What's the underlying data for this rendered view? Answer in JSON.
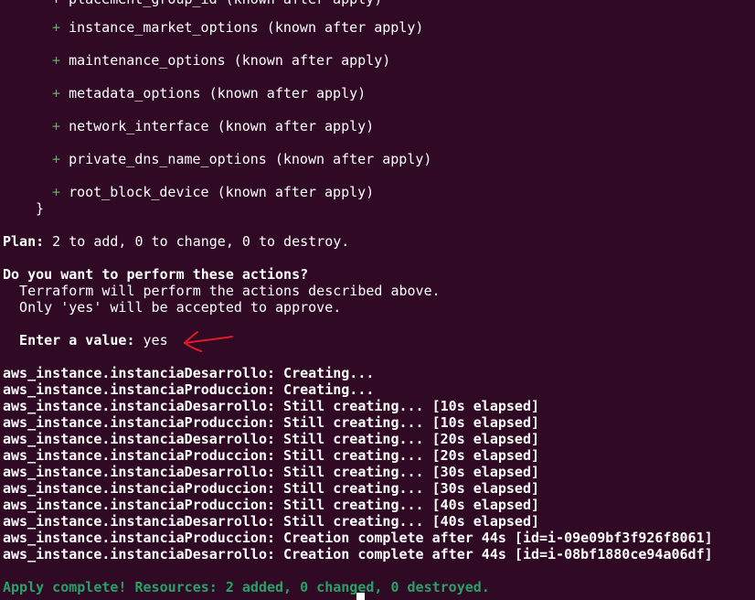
{
  "terminal": {
    "partial_top_line": "+ placement_group_id (known after apply)",
    "attributes": [
      {
        "marker": "+",
        "text": "instance_market_options (known after apply)"
      },
      {
        "marker": "+",
        "text": "maintenance_options (known after apply)"
      },
      {
        "marker": "+",
        "text": "metadata_options (known after apply)"
      },
      {
        "marker": "+",
        "text": "network_interface (known after apply)"
      },
      {
        "marker": "+",
        "text": "private_dns_name_options (known after apply)"
      },
      {
        "marker": "+",
        "text": "root_block_device (known after apply)"
      }
    ],
    "closing_brace": "}",
    "plan_label": "Plan:",
    "plan_text": " 2 to add, 0 to change, 0 to destroy.",
    "question": "Do you want to perform these actions?",
    "explain_1": "  Terraform will perform the actions described above.",
    "explain_2": "  Only 'yes' will be accepted to approve.",
    "prompt_label": "  Enter a value:",
    "prompt_value": " yes",
    "progress": [
      "aws_instance.instanciaDesarrollo: Creating...",
      "aws_instance.instanciaProduccion: Creating...",
      "aws_instance.instanciaDesarrollo: Still creating... [10s elapsed]",
      "aws_instance.instanciaProduccion: Still creating... [10s elapsed]",
      "aws_instance.instanciaDesarrollo: Still creating... [20s elapsed]",
      "aws_instance.instanciaProduccion: Still creating... [20s elapsed]",
      "aws_instance.instanciaDesarrollo: Still creating... [30s elapsed]",
      "aws_instance.instanciaProduccion: Still creating... [30s elapsed]",
      "aws_instance.instanciaProduccion: Still creating... [40s elapsed]",
      "aws_instance.instanciaDesarrollo: Still creating... [40s elapsed]",
      "aws_instance.instanciaProduccion: Creation complete after 44s [id=i-09e09bf3f926f8061]",
      "aws_instance.instanciaDesarrollo: Creation complete after 44s [id=i-08bf1880ce94a06df]"
    ],
    "apply_complete": "Apply complete! Resources: 2 added, 0 changed, 0 destroyed.",
    "annotation_arrow": "red-hand-drawn-arrow-icon",
    "colors": {
      "background": "#300a24",
      "text": "#ffffff",
      "plus_marker": "#4ebb4e",
      "success": "#26a269",
      "annotation": "#e01b24"
    }
  }
}
